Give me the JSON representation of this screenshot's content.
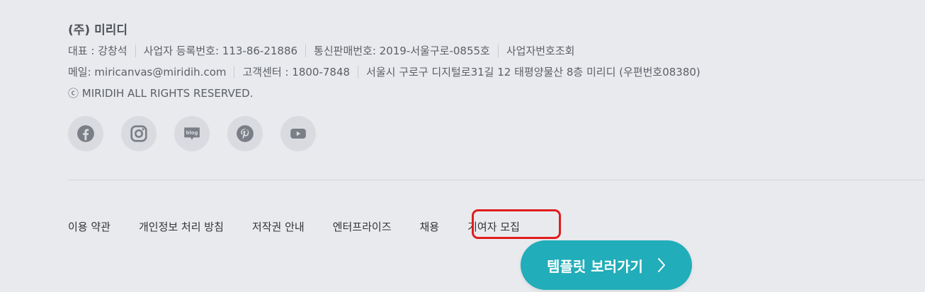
{
  "company": {
    "name": "(주) 미리디"
  },
  "info": {
    "row1": [
      "대표 : 강창석",
      "사업자 등록번호: 113-86-21886",
      "통신판매번호: 2019-서울구로-0855호",
      "사업자번호조회"
    ],
    "row2": [
      "메일: miricanvas@miridih.com",
      "고객센터 : 1800-7848",
      "서울시 구로구 디지털로31길 12 태평양물산 8층 미리디 (우편번호08380)"
    ],
    "copyright": "ⓒ MIRIDIH ALL RIGHTS RESERVED."
  },
  "socials": [
    "facebook-icon",
    "instagram-icon",
    "blog-icon",
    "pinterest-icon",
    "youtube-icon"
  ],
  "blog_icon_text": "blog",
  "links": [
    "이용 약관",
    "개인정보 처리 방침",
    "저작권 안내",
    "엔터프라이즈",
    "채용",
    "기여자 모집"
  ],
  "cta": {
    "label": "템플릿 보러가기"
  },
  "colors": {
    "background": "#e9eaee",
    "accent": "#21adb9",
    "highlight": "#e01d1d",
    "icon": "#7a7e86"
  }
}
